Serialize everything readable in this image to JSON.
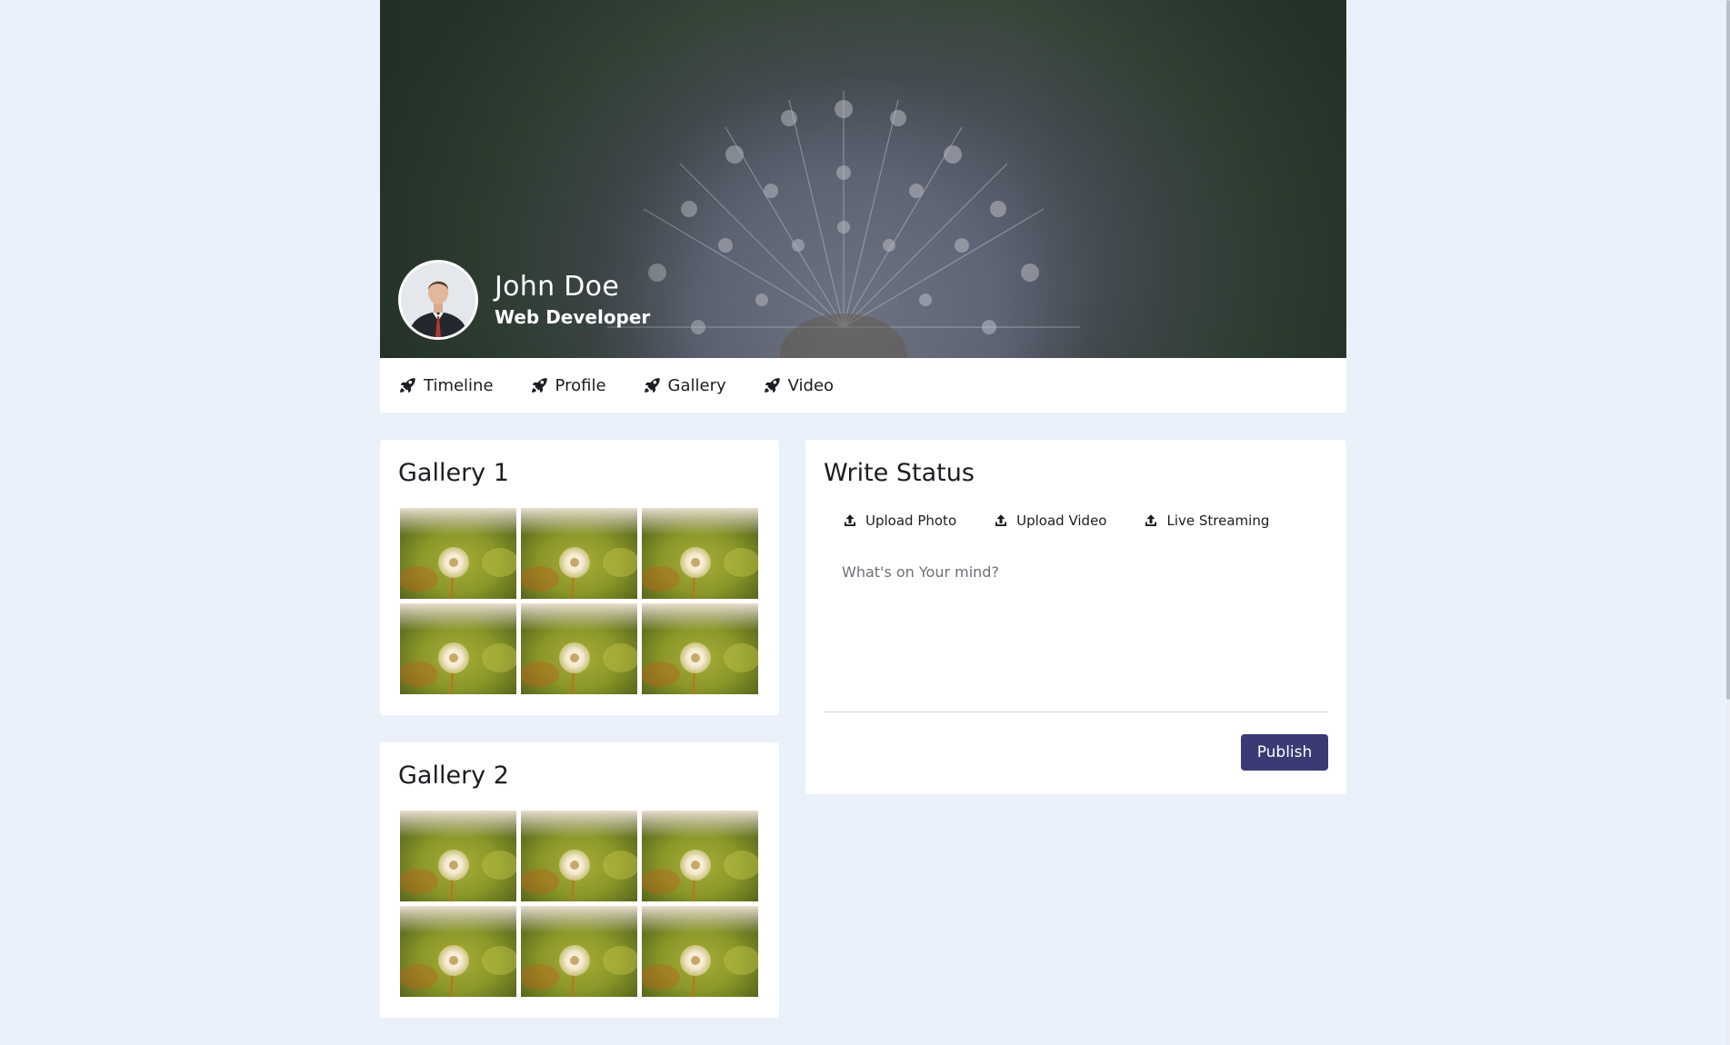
{
  "profile": {
    "name": "John Doe",
    "role": "Web Developer"
  },
  "nav": {
    "items": [
      {
        "label": "Timeline",
        "icon": "rocket-icon"
      },
      {
        "label": "Profile",
        "icon": "rocket-icon"
      },
      {
        "label": "Gallery",
        "icon": "rocket-icon"
      },
      {
        "label": "Video",
        "icon": "rocket-icon"
      }
    ]
  },
  "galleries": [
    {
      "title": "Gallery 1",
      "photo_count": 6
    },
    {
      "title": "Gallery 2",
      "photo_count": 6
    }
  ],
  "status": {
    "title": "Write Status",
    "actions": [
      {
        "label": "Upload Photo",
        "icon": "upload-icon"
      },
      {
        "label": "Upload Video",
        "icon": "upload-icon"
      },
      {
        "label": "Live Streaming",
        "icon": "upload-icon"
      }
    ],
    "placeholder": "What's on Your mind?",
    "publish_label": "Publish"
  },
  "colors": {
    "page_background": "#eaf1fb",
    "accent": "#3a3a75",
    "card_background": "#ffffff"
  }
}
